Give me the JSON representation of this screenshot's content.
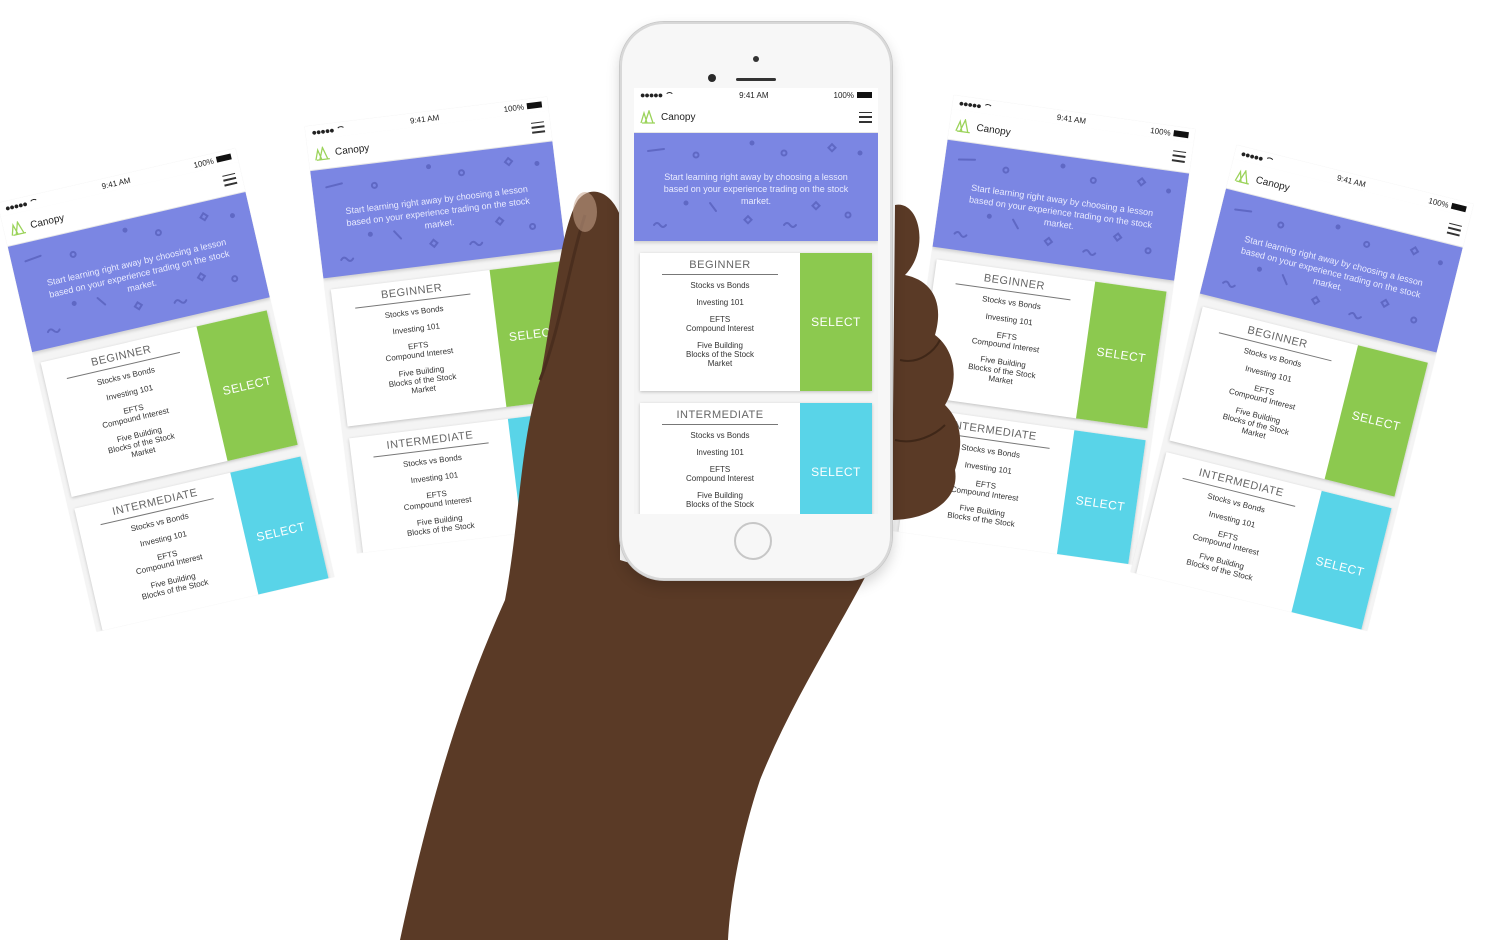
{
  "status": {
    "time": "9:41 AM",
    "battery": "100%"
  },
  "app": {
    "name": "Canopy"
  },
  "hero": {
    "text": "Start learning right away by choosing a lesson based on your experience trading on the stock market."
  },
  "levels": [
    {
      "name": "BEGINNER",
      "lessons": [
        "Stocks vs Bonds",
        "Investing 101",
        "EFTS\nCompound Interest",
        "Five Building\nBlocks of the Stock\nMarket"
      ],
      "button": "SELECT",
      "button_color": "#8cc94f"
    },
    {
      "name": "INTERMEDIATE",
      "lessons": [
        "Stocks vs Bonds",
        "Investing 101",
        "EFTS\nCompound Interest",
        "Five Building\nBlocks of the Stock"
      ],
      "button": "SELECT",
      "button_color": "#59d4e8"
    }
  ],
  "colors": {
    "hero": "#7b86e3",
    "accent_green": "#8cc94f",
    "accent_blue": "#59d4e8",
    "skin": "#5a3a26"
  },
  "icons": [
    "canopy-logo-icon",
    "hamburger-menu-icon",
    "wifi-icon",
    "battery-icon",
    "home-button-icon"
  ]
}
